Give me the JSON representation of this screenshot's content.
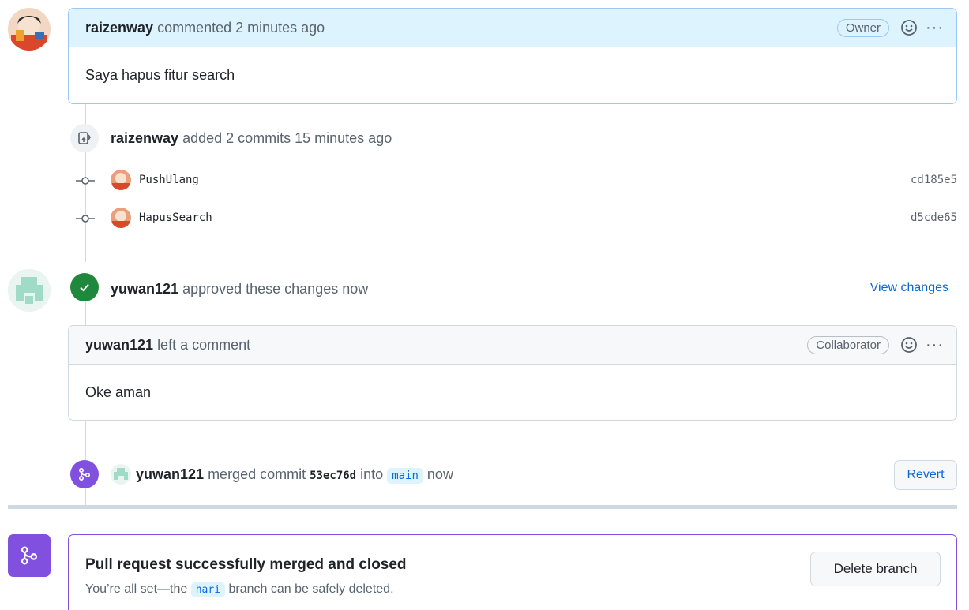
{
  "owner_comment": {
    "author": "raizenway",
    "action": "commented 2 minutes ago",
    "badge": "Owner",
    "body": "Saya hapus fitur search"
  },
  "commits_event": {
    "author": "raizenway",
    "action": "added 2 commits 15 minutes ago",
    "commits": [
      {
        "message": "PushUlang",
        "sha": "cd185e5"
      },
      {
        "message": "HapusSearch",
        "sha": "d5cde65"
      }
    ]
  },
  "approval": {
    "author": "yuwan121",
    "action": "approved these changes now",
    "view_changes": "View changes"
  },
  "review_comment": {
    "author": "yuwan121",
    "action": "left a comment",
    "badge": "Collaborator",
    "body": "Oke aman"
  },
  "merge_event": {
    "author": "yuwan121",
    "action_prefix": "merged commit",
    "commit": "53ec76d",
    "into": "into",
    "branch": "main",
    "time": "now",
    "revert_label": "Revert"
  },
  "merged_box": {
    "title": "Pull request successfully merged and closed",
    "text_prefix": "You’re all set—the",
    "branch": "hari",
    "text_suffix": "branch can be safely deleted.",
    "delete_label": "Delete branch"
  },
  "colors": {
    "accent": "#0969da",
    "success": "#1f883d",
    "merged": "#8250df",
    "owner_header_bg": "#ddf4ff"
  }
}
